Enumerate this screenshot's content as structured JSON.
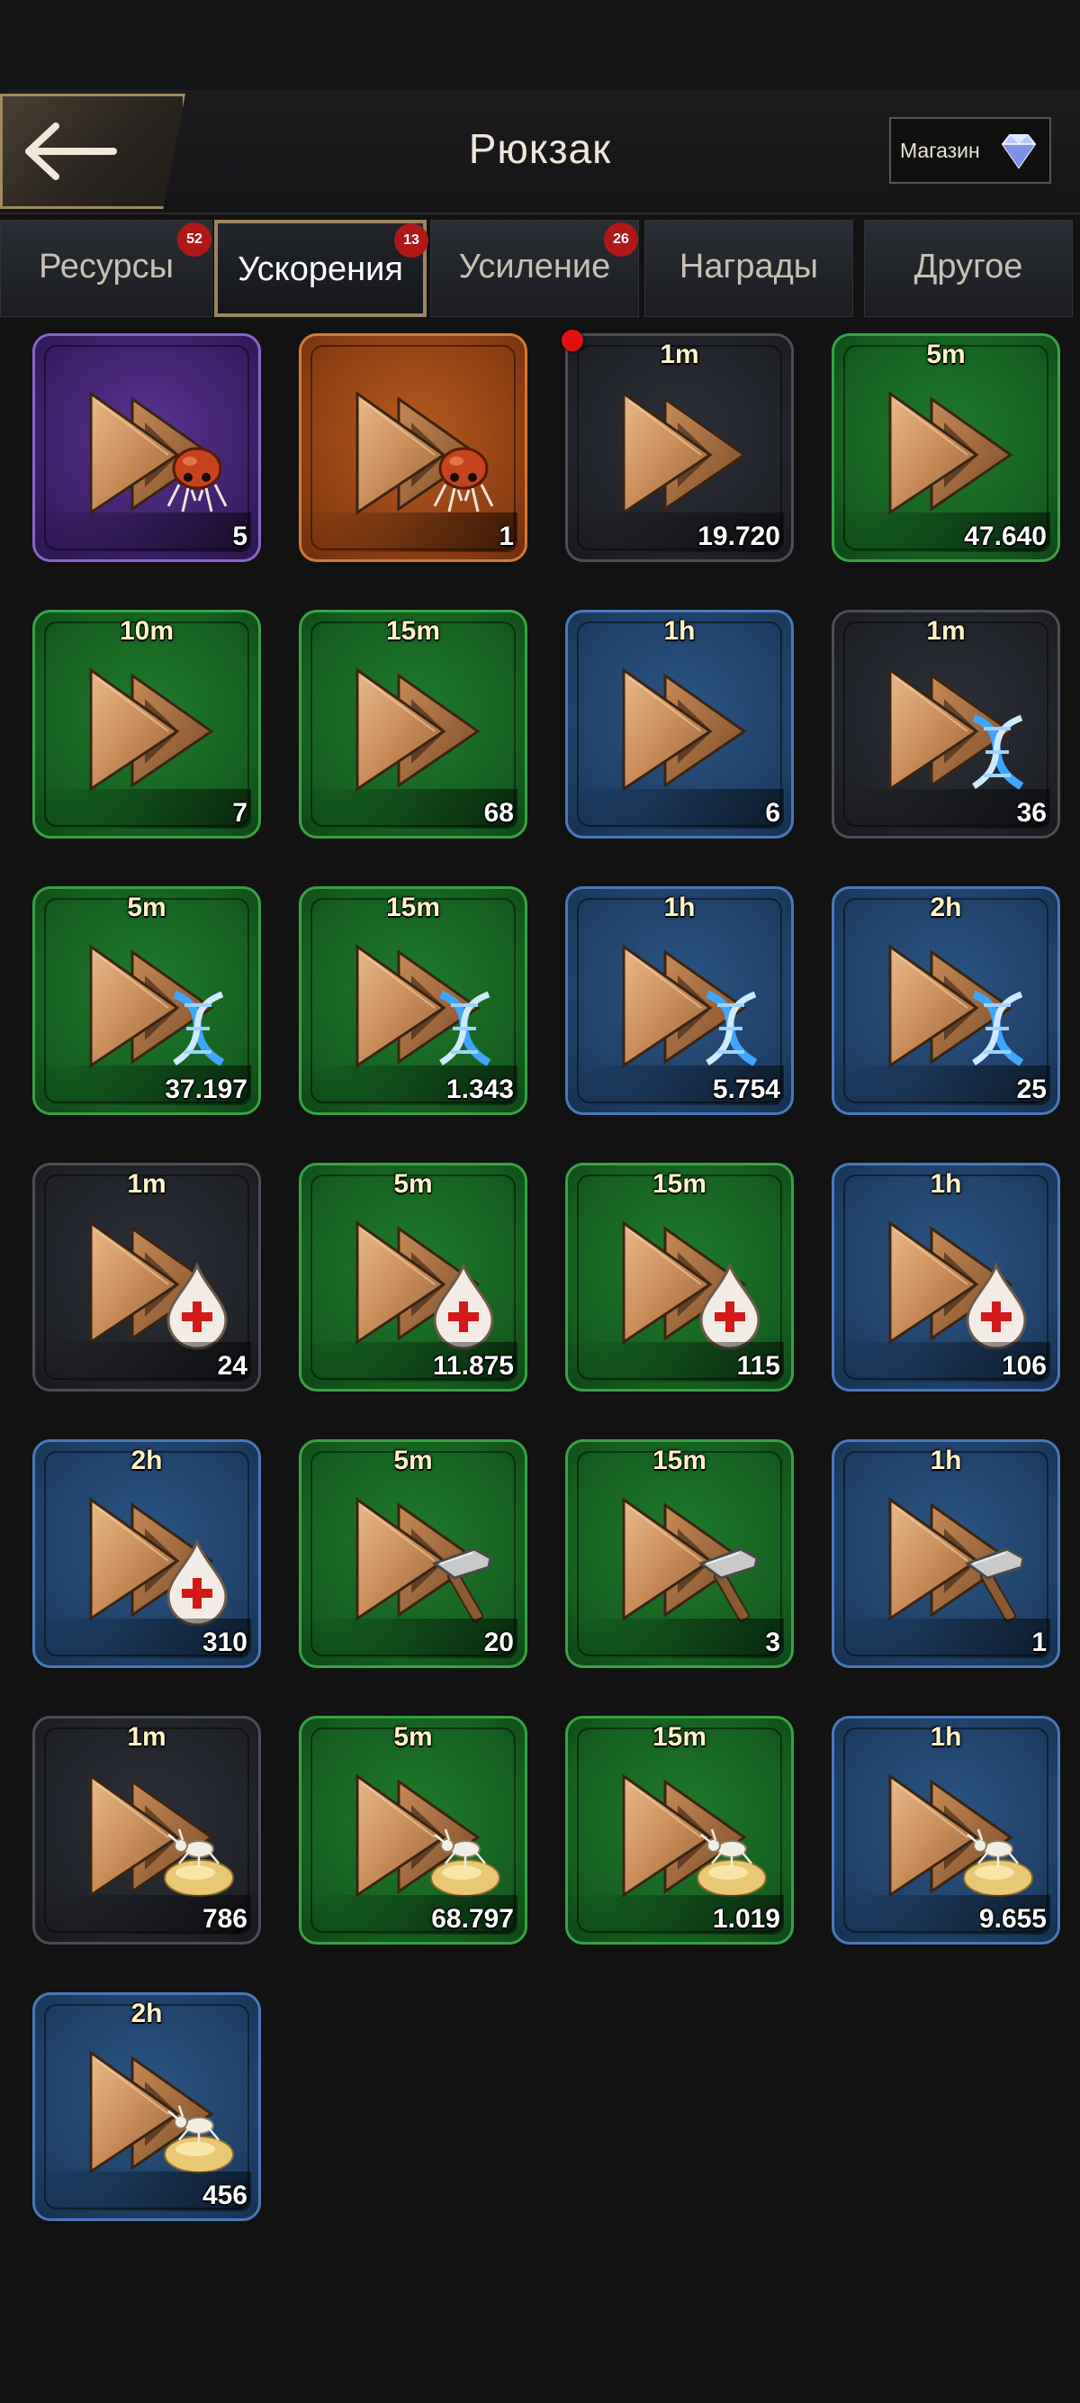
{
  "header": {
    "title": "Рюкзак",
    "shop_label": "Магазин"
  },
  "tabs": [
    {
      "label": "Ресурсы",
      "badge": "52",
      "active": false
    },
    {
      "label": "Ускорения",
      "badge": "13",
      "active": true
    },
    {
      "label": "Усиление",
      "badge": "26",
      "active": false
    },
    {
      "label": "Награды",
      "badge": "",
      "active": false
    },
    {
      "label": "Другое",
      "badge": "",
      "active": false
    }
  ],
  "items": [
    {
      "rarity": "purple",
      "icon": "ant-icon",
      "duration": "",
      "quantity": "5",
      "new": false
    },
    {
      "rarity": "orange",
      "icon": "ant-icon",
      "duration": "",
      "quantity": "1",
      "new": false
    },
    {
      "rarity": "gray",
      "icon": "",
      "duration": "1m",
      "quantity": "19.720",
      "new": true
    },
    {
      "rarity": "green",
      "icon": "",
      "duration": "5m",
      "quantity": "47.640",
      "new": false
    },
    {
      "rarity": "green",
      "icon": "",
      "duration": "10m",
      "quantity": "7",
      "new": false
    },
    {
      "rarity": "green",
      "icon": "",
      "duration": "15m",
      "quantity": "68",
      "new": false
    },
    {
      "rarity": "blue",
      "icon": "",
      "duration": "1h",
      "quantity": "6",
      "new": false
    },
    {
      "rarity": "gray",
      "icon": "dna-icon",
      "duration": "1m",
      "quantity": "36",
      "new": false
    },
    {
      "rarity": "green",
      "icon": "dna-icon",
      "duration": "5m",
      "quantity": "37.197",
      "new": false
    },
    {
      "rarity": "green",
      "icon": "dna-icon",
      "duration": "15m",
      "quantity": "1.343",
      "new": false
    },
    {
      "rarity": "blue",
      "icon": "dna-icon",
      "duration": "1h",
      "quantity": "5.754",
      "new": false
    },
    {
      "rarity": "blue",
      "icon": "dna-icon",
      "duration": "2h",
      "quantity": "25",
      "new": false
    },
    {
      "rarity": "gray",
      "icon": "blood-drop-icon",
      "duration": "1m",
      "quantity": "24",
      "new": false
    },
    {
      "rarity": "green",
      "icon": "blood-drop-icon",
      "duration": "5m",
      "quantity": "11.875",
      "new": false
    },
    {
      "rarity": "green",
      "icon": "blood-drop-icon",
      "duration": "15m",
      "quantity": "115",
      "new": false
    },
    {
      "rarity": "blue",
      "icon": "blood-drop-icon",
      "duration": "1h",
      "quantity": "106",
      "new": false
    },
    {
      "rarity": "blue",
      "icon": "blood-drop-icon",
      "duration": "2h",
      "quantity": "310",
      "new": false
    },
    {
      "rarity": "green",
      "icon": "hammer-icon",
      "duration": "5m",
      "quantity": "20",
      "new": false
    },
    {
      "rarity": "green",
      "icon": "hammer-icon",
      "duration": "15m",
      "quantity": "3",
      "new": false
    },
    {
      "rarity": "blue",
      "icon": "hammer-icon",
      "duration": "1h",
      "quantity": "1",
      "new": false
    },
    {
      "rarity": "gray",
      "icon": "ant-larva-icon",
      "duration": "1m",
      "quantity": "786",
      "new": false
    },
    {
      "rarity": "green",
      "icon": "ant-larva-icon",
      "duration": "5m",
      "quantity": "68.797",
      "new": false
    },
    {
      "rarity": "green",
      "icon": "ant-larva-icon",
      "duration": "15m",
      "quantity": "1.019",
      "new": false
    },
    {
      "rarity": "blue",
      "icon": "ant-larva-icon",
      "duration": "1h",
      "quantity": "9.655",
      "new": false
    },
    {
      "rarity": "blue",
      "icon": "ant-larva-icon",
      "duration": "2h",
      "quantity": "456",
      "new": false
    }
  ]
}
